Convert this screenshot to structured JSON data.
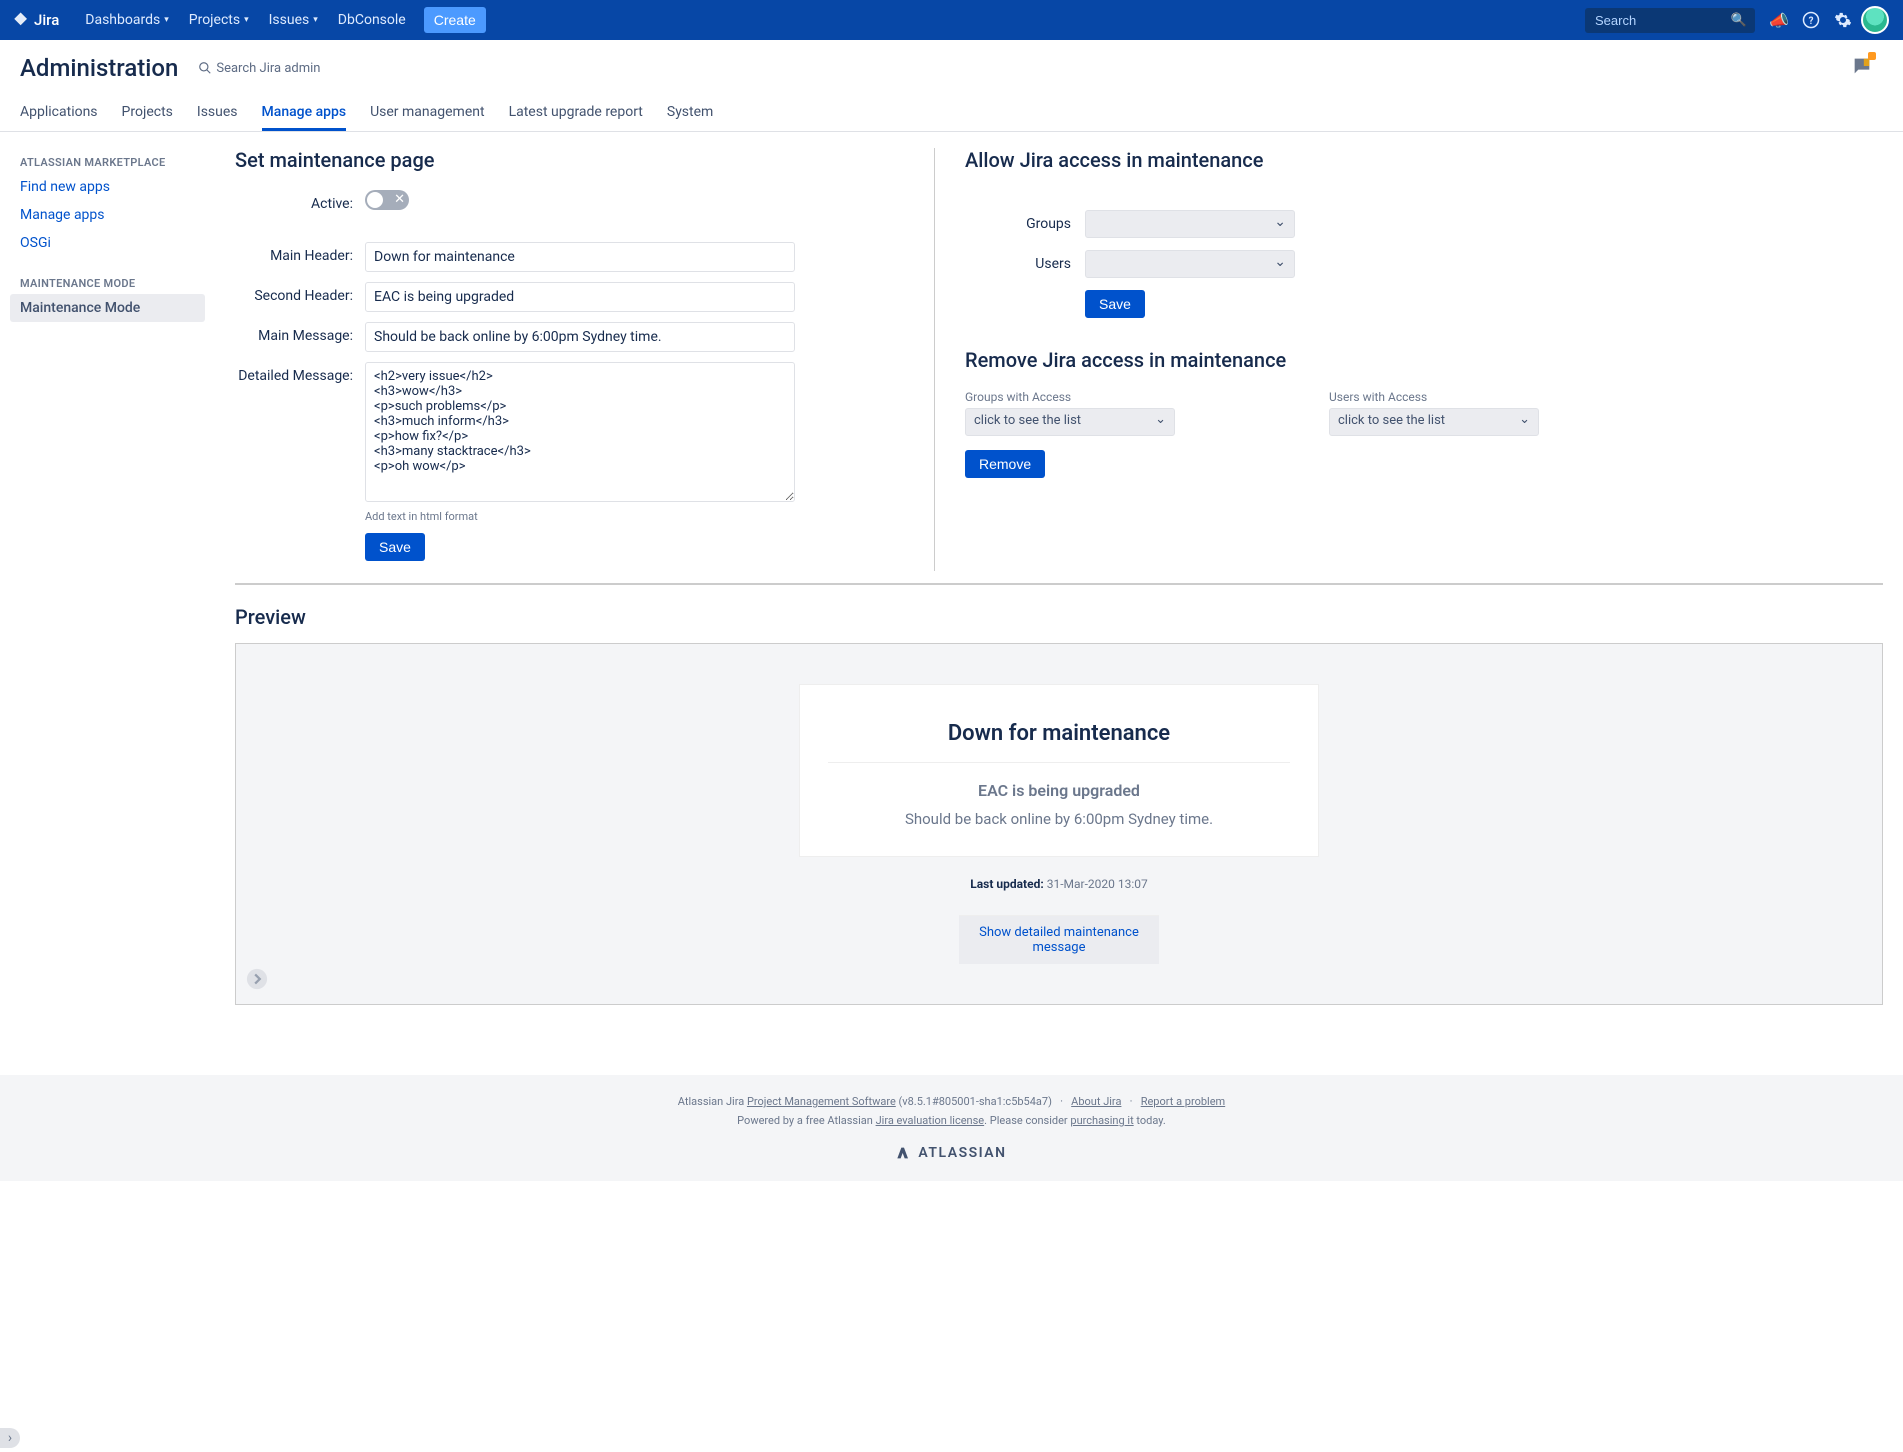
{
  "topnav": {
    "logo": "Jira",
    "items": [
      "Dashboards",
      "Projects",
      "Issues",
      "DbConsole"
    ],
    "create": "Create",
    "search_placeholder": "Search"
  },
  "admin": {
    "title": "Administration",
    "search_placeholder": "Search Jira admin"
  },
  "tabs": [
    "Applications",
    "Projects",
    "Issues",
    "Manage apps",
    "User management",
    "Latest upgrade report",
    "System"
  ],
  "active_tab": "Manage apps",
  "sidebar": {
    "sections": [
      {
        "title": "ATLASSIAN MARKETPLACE",
        "items": [
          "Find new apps",
          "Manage apps",
          "OSGi"
        ]
      },
      {
        "title": "MAINTENANCE MODE",
        "items": [
          "Maintenance Mode"
        ]
      }
    ],
    "active": "Maintenance Mode"
  },
  "form": {
    "heading": "Set maintenance page",
    "active_label": "Active:",
    "main_header_label": "Main Header:",
    "main_header_value": "Down for maintenance",
    "second_header_label": "Second Header:",
    "second_header_value": "EAC is being upgraded",
    "main_message_label": "Main Message:",
    "main_message_value": "Should be back online by 6:00pm Sydney time.",
    "detailed_label": "Detailed Message:",
    "detailed_value": "<h2>very issue</h2>\n<h3>wow</h3>\n<p>such problems</p>\n<h3>much inform</h3>\n<p>how fix?</p>\n<h3>many stacktrace</h3>\n<p>oh wow</p>",
    "detailed_help": "Add text in html format",
    "save": "Save"
  },
  "allow": {
    "heading": "Allow Jira access in maintenance",
    "groups_label": "Groups",
    "users_label": "Users",
    "save": "Save"
  },
  "remove": {
    "heading": "Remove Jira access in maintenance",
    "groups_label": "Groups with Access",
    "users_label": "Users with Access",
    "list_placeholder": "click to see the list",
    "remove": "Remove"
  },
  "preview": {
    "heading": "Preview",
    "title": "Down for maintenance",
    "subtitle": "EAC is being upgraded",
    "message": "Should be back online by 6:00pm Sydney time.",
    "last_updated_label": "Last updated:",
    "last_updated_value": "31-Mar-2020 13:07",
    "detail_btn": "Show detailed maintenance message"
  },
  "footer": {
    "line1_a": "Atlassian Jira ",
    "line1_link": "Project Management Software",
    "line1_b": " (v8.5.1#805001-sha1:c5b54a7)",
    "about": "About Jira",
    "report": "Report a problem",
    "line2_a": "Powered by a free Atlassian ",
    "line2_link1": "Jira evaluation license",
    "line2_b": ". Please consider ",
    "line2_link2": "purchasing it",
    "line2_c": " today.",
    "brand": "ATLASSIAN"
  }
}
